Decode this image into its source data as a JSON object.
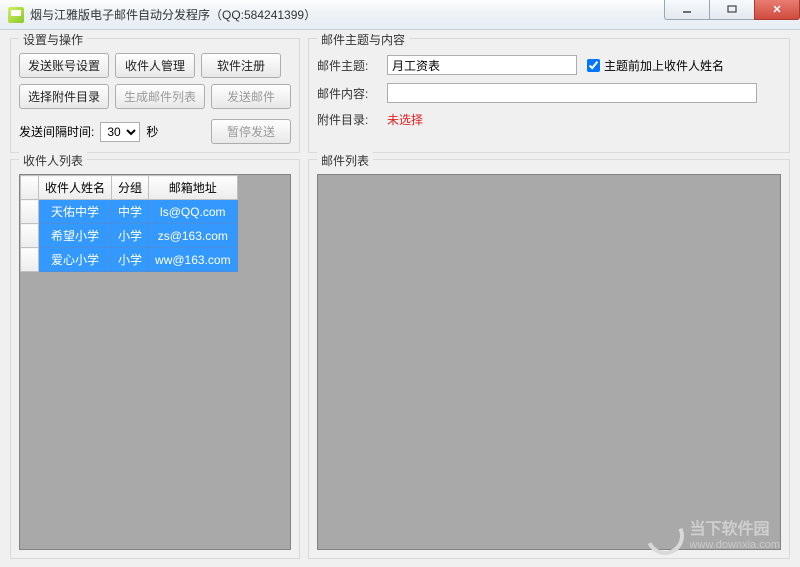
{
  "window": {
    "title": "烟与江雅版电子邮件自动分发程序（QQ:584241399）"
  },
  "settings": {
    "legend": "设置与操作",
    "btn_account": "发送账号设置",
    "btn_recipients": "收件人管理",
    "btn_register": "软件注册",
    "btn_choose_dir": "选择附件目录",
    "btn_gen_list": "生成邮件列表",
    "btn_send": "发送邮件",
    "interval_label": "发送间隔时间:",
    "interval_value": "30",
    "interval_unit": "秒",
    "btn_pause": "暂停发送"
  },
  "subject": {
    "legend": "邮件主题与内容",
    "label_subject": "邮件主题:",
    "value_subject": "月工资表",
    "chk_prefix": "主题前加上收件人姓名",
    "label_content": "邮件内容:",
    "value_content": "",
    "label_attach": "附件目录:",
    "value_attach": "未选择"
  },
  "recips": {
    "legend": "收件人列表",
    "cols": {
      "name": "收件人姓名",
      "group": "分组",
      "email": "邮箱地址"
    },
    "rows": [
      {
        "name": "天佑中学",
        "group": "中学",
        "email": "ls@QQ.com"
      },
      {
        "name": "希望小学",
        "group": "小学",
        "email": "zs@163.com"
      },
      {
        "name": "爱心小学",
        "group": "小学",
        "email": "ww@163.com"
      }
    ]
  },
  "maillist": {
    "legend": "邮件列表"
  },
  "watermark": {
    "cn": "当下软件园",
    "en": "www.downxia.com"
  }
}
